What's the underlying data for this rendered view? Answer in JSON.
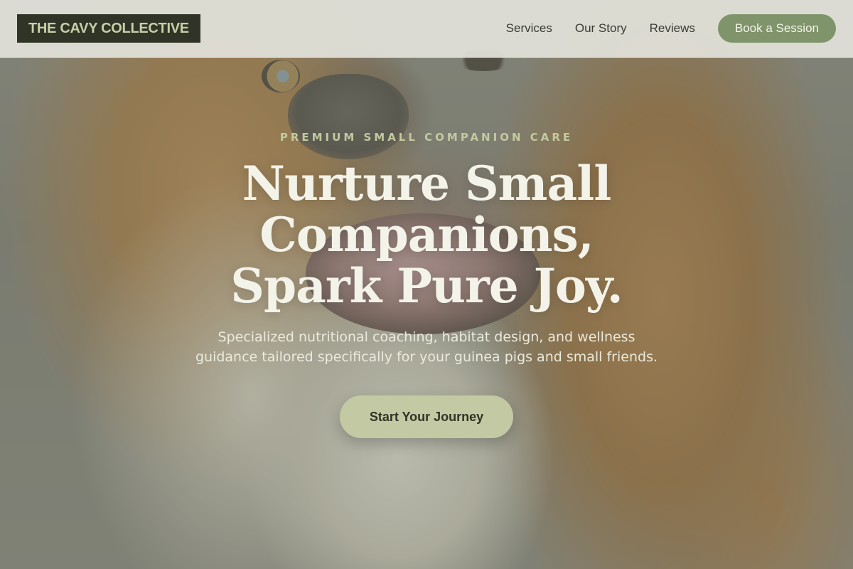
{
  "header": {
    "logo": "THE CAVY COLLECTIVE",
    "nav": {
      "services": "Services",
      "our_story": "Our Story",
      "reviews": "Reviews",
      "cta": "Book a Session"
    }
  },
  "hero": {
    "eyebrow": "PREMIUM SMALL COMPANION CARE",
    "headline_lines": [
      "Nurture Small",
      "Companions,",
      "Spark Pure Joy."
    ],
    "subtext_lines": [
      "Specialized nutritional coaching, habitat design, and wellness",
      "guidance tailored specifically for your guinea pigs and small friends."
    ],
    "cta": "Start Your Journey"
  },
  "colors": {
    "logo_bg": "#2f3426",
    "logo_text": "#c6cfa8",
    "accent_button": "#7f946a",
    "hero_button": "#c3c9a3",
    "eyebrow": "#c3ca9f",
    "headline": "#f4f3e9"
  }
}
